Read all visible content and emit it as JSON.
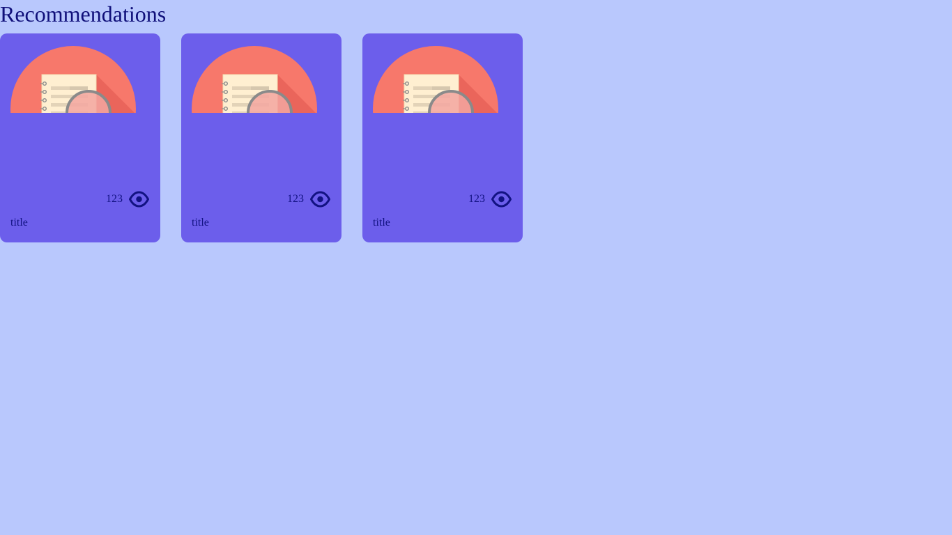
{
  "page": {
    "title": "Recommendations"
  },
  "cards": [
    {
      "title": "title",
      "views": "123",
      "thumbnail_icon": "notebook-magnifier-icon",
      "views_icon": "eye-icon"
    },
    {
      "title": "title",
      "views": "123",
      "thumbnail_icon": "notebook-magnifier-icon",
      "views_icon": "eye-icon"
    },
    {
      "title": "title",
      "views": "123",
      "thumbnail_icon": "notebook-magnifier-icon",
      "views_icon": "eye-icon"
    }
  ],
  "colors": {
    "background": "#b9c8fd",
    "card": "#6c5eeb",
    "text": "#121282",
    "thumbnail_circle": "#f7786b",
    "notebook_paper": "#ffefd1"
  }
}
